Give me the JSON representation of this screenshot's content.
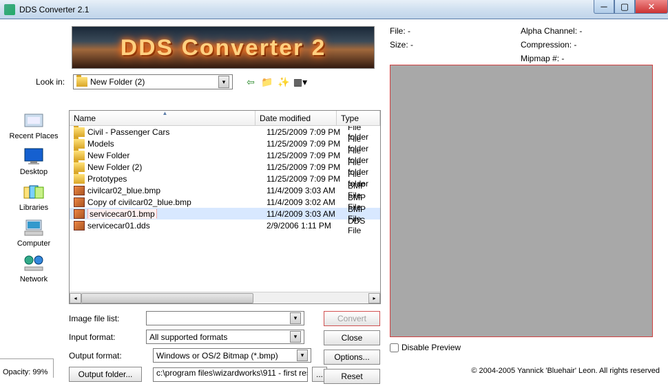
{
  "window": {
    "title": "DDS Converter 2.1"
  },
  "banner": {
    "text": "DDS Converter 2"
  },
  "lookin": {
    "label": "Look in:",
    "value": "New Folder (2)"
  },
  "places": [
    {
      "label": "Recent Places"
    },
    {
      "label": "Desktop"
    },
    {
      "label": "Libraries"
    },
    {
      "label": "Computer"
    },
    {
      "label": "Network"
    }
  ],
  "columns": {
    "name": "Name",
    "date": "Date modified",
    "type": "Type"
  },
  "files": [
    {
      "icon": "folder",
      "name": "Civil - Passenger Cars",
      "date": "11/25/2009 7:09 PM",
      "type": "File folder",
      "selected": false
    },
    {
      "icon": "folder",
      "name": "Models",
      "date": "11/25/2009 7:09 PM",
      "type": "File folder",
      "selected": false
    },
    {
      "icon": "folder",
      "name": "New Folder",
      "date": "11/25/2009 7:09 PM",
      "type": "File folder",
      "selected": false
    },
    {
      "icon": "folder",
      "name": "New Folder (2)",
      "date": "11/25/2009 7:09 PM",
      "type": "File folder",
      "selected": false
    },
    {
      "icon": "folder",
      "name": "Prototypes",
      "date": "11/25/2009 7:09 PM",
      "type": "File folder",
      "selected": false
    },
    {
      "icon": "bmp",
      "name": "civilcar02_blue.bmp",
      "date": "11/4/2009 3:03 AM",
      "type": "BMP File",
      "selected": false
    },
    {
      "icon": "bmp",
      "name": "Copy of civilcar02_blue.bmp",
      "date": "11/4/2009 3:02 AM",
      "type": "BMP File",
      "selected": false
    },
    {
      "icon": "bmp",
      "name": "servicecar01.bmp",
      "date": "11/4/2009 3:03 AM",
      "type": "BMP File",
      "selected": true
    },
    {
      "icon": "dds",
      "name": "servicecar01.dds",
      "date": "2/9/2006 1:11 PM",
      "type": "DDS File",
      "selected": false
    }
  ],
  "controls": {
    "image_file_list_label": "Image file list:",
    "image_file_list_value": "",
    "input_format_label": "Input format:",
    "input_format_value": "All supported formats",
    "output_format_label": "Output format:",
    "output_format_value": "Windows or OS/2 Bitmap (*.bmp)",
    "output_folder_btn": "Output folder...",
    "output_folder_value": "c:\\program files\\wizardworks\\911 - first res",
    "browse_btn": "..."
  },
  "actions": {
    "convert": "Convert",
    "close": "Close",
    "options": "Options...",
    "reset": "Reset"
  },
  "info": {
    "file_label": "File: -",
    "size_label": "Size: -",
    "alpha_label": "Alpha Channel: -",
    "compression_label": "Compression: -",
    "mipmap_label": "Mipmap #: -"
  },
  "preview": {
    "disable_label": "Disable Preview"
  },
  "footer": {
    "opacity": "Opacity: 99%",
    "copyright": "© 2004-2005 Yannick 'Bluehair' Leon. All rights reserved"
  }
}
